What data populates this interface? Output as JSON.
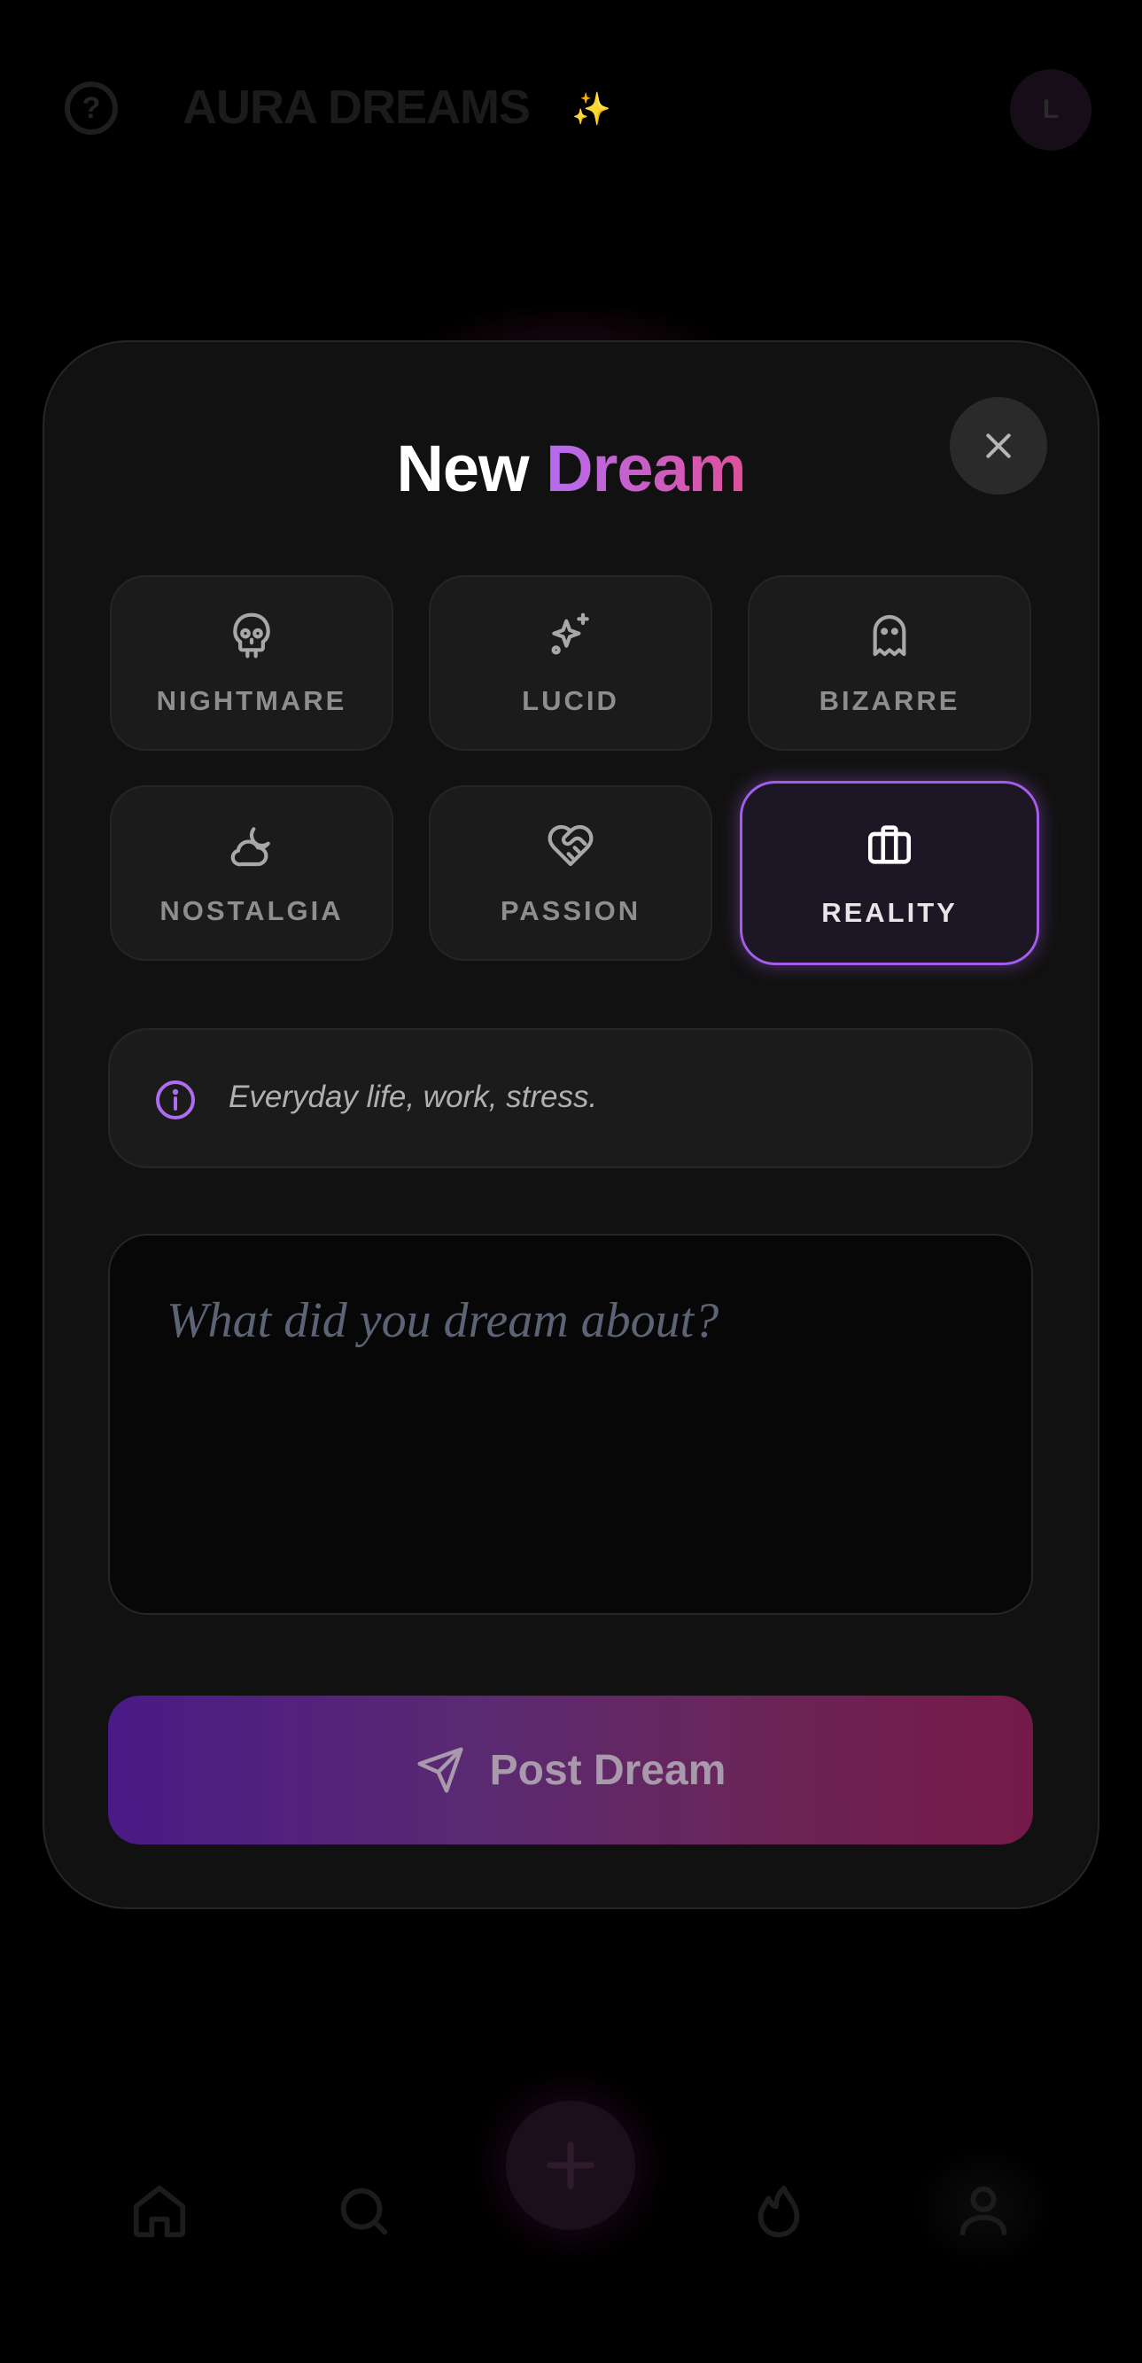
{
  "app": {
    "title": "AURA DREAMS",
    "title_mark": "✨",
    "help_glyph": "?",
    "avatar_initial": "L"
  },
  "modal": {
    "title_part1": "New",
    "title_part2": "Dream",
    "close_icon": "close-icon",
    "categories": [
      {
        "label": "NIGHTMARE",
        "icon": "skull-icon",
        "selected": false
      },
      {
        "label": "LUCID",
        "icon": "sparkles-icon",
        "selected": false
      },
      {
        "label": "BIZARRE",
        "icon": "ghost-icon",
        "selected": false
      },
      {
        "label": "NOSTALGIA",
        "icon": "cloud-moon-icon",
        "selected": false
      },
      {
        "label": "PASSION",
        "icon": "heart-handshake-icon",
        "selected": false
      },
      {
        "label": "REALITY",
        "icon": "briefcase-icon",
        "selected": true
      }
    ],
    "info_text": "Everyday life, work, stress.",
    "dream_input": {
      "value": "",
      "placeholder": "What did you dream about?"
    },
    "post_label": "Post Dream"
  },
  "bottom_nav": {
    "items": [
      "home-icon",
      "search-icon",
      "add-icon",
      "flame-icon",
      "user-icon"
    ]
  },
  "colors": {
    "accent_purple": "#a35de8",
    "accent_pink": "#e0509a",
    "background": "#000000",
    "modal_bg": "#111111"
  }
}
